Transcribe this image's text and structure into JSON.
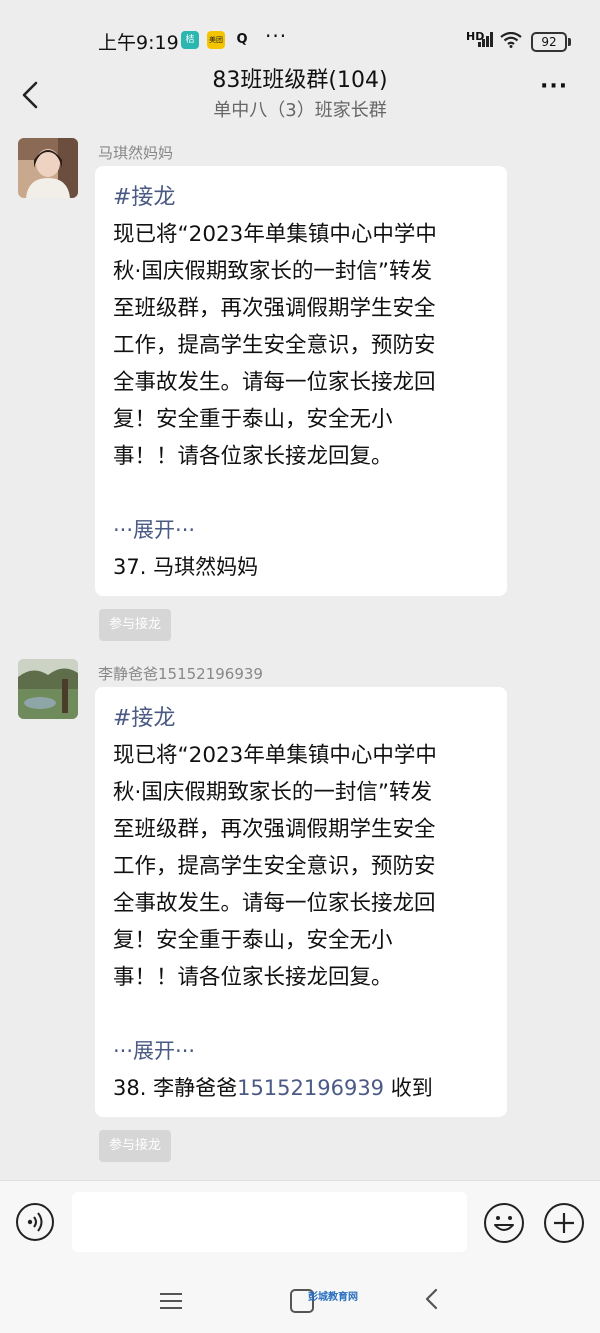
{
  "status_bar": {
    "time": "上午9:19",
    "app_icons": [
      {
        "label": "桔",
        "color": "#2bb6b0"
      },
      {
        "label": "美团",
        "color": "#f5c400"
      },
      {
        "label": "Q",
        "color": "#ffffff"
      }
    ],
    "more": "···",
    "network": "HD",
    "battery": "92"
  },
  "header": {
    "title": "83班班级群(104)",
    "subtitle": "单中八（3）班家长群",
    "more_label": "···"
  },
  "messages": [
    {
      "sender": "马琪然妈妈",
      "tag": "#接龙",
      "lines": [
        "现已将“2023年单集镇中心中学中",
        "秋·国庆假期致家长的一封信”转发",
        "至班级群，再次强调假期学生安全",
        "工作，提高学生安全意识，预防安",
        "全事故发生。请每一位家长接龙回",
        "复！安全重于泰山，安全无小",
        "事！！请各位家长接龙回复。"
      ],
      "expand": "···展开···",
      "reply_prefix": "37. 马琪然妈妈",
      "reply_phone": "",
      "reply_suffix": "",
      "join_label": "参与接龙"
    },
    {
      "sender": "李静爸爸15152196939",
      "tag": "#接龙",
      "lines": [
        "现已将“2023年单集镇中心中学中",
        "秋·国庆假期致家长的一封信”转发",
        "至班级群，再次强调假期学生安全",
        "工作，提高学生安全意识，预防安",
        "全事故发生。请每一位家长接龙回",
        "复！安全重于泰山，安全无小",
        "事！！请各位家长接龙回复。"
      ],
      "expand": "···展开···",
      "reply_prefix": "38. 李静爸爸",
      "reply_phone": "15152196939",
      "reply_suffix": " 收到",
      "join_label": "参与接龙"
    }
  ],
  "input_bar": {
    "placeholder": ""
  },
  "watermark": "彭城教育网",
  "colors": {
    "background": "#ededed",
    "bubble": "#ffffff",
    "accent_text": "#4a5a85",
    "join_button": "#d6d6d6"
  }
}
